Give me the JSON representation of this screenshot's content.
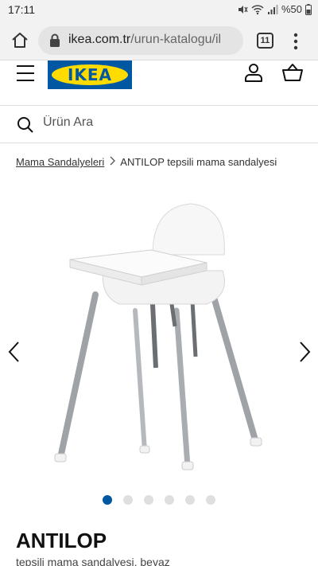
{
  "status_bar": {
    "time": "17:11",
    "battery": "%50"
  },
  "browser": {
    "url_domain": "ikea.com.tr",
    "url_path": "/urun-katalogu/il",
    "tab_count": "11"
  },
  "site": {
    "logo_text": "IKEA",
    "search": {
      "placeholder": "Ürün Ara"
    }
  },
  "breadcrumb": {
    "parent": "Mama Sandalyeleri",
    "current": "ANTILOP tepsili mama sandalyesi"
  },
  "gallery": {
    "image_count": 6,
    "active_index": 0
  },
  "product": {
    "name": "ANTILOP",
    "description": "tepsili mama sandalyesi, beyaz"
  },
  "colors": {
    "ikea_blue": "#0058a3",
    "ikea_yellow": "#ffdb00"
  }
}
